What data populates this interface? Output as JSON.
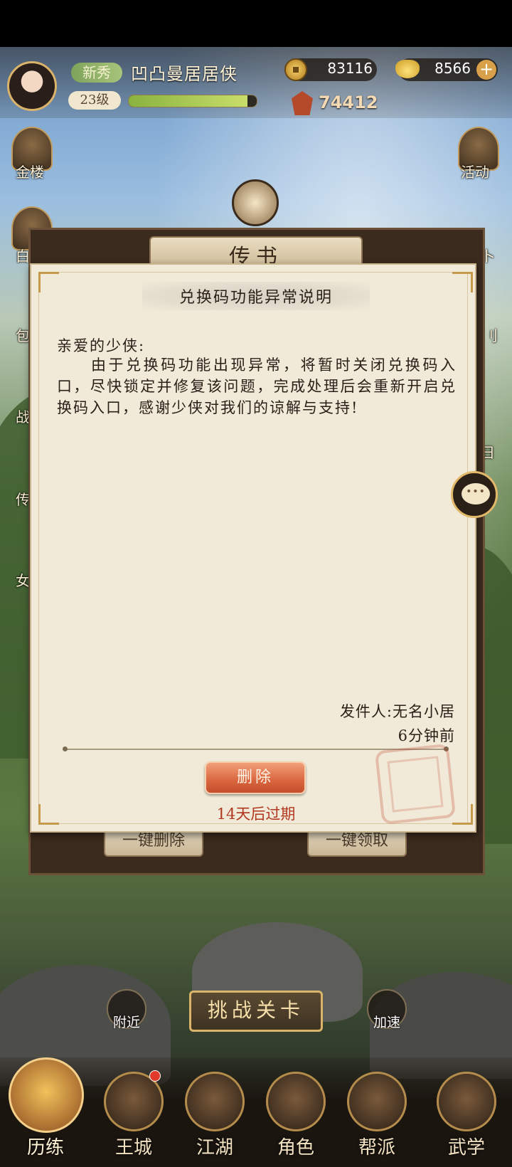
{
  "header": {
    "rank_tag": "新秀",
    "player_name": "凹凸曼居居侠",
    "level": "23级",
    "exp_progress": 0.93,
    "coins": "83116",
    "ingots": "8566",
    "power": "74412"
  },
  "side_left": {
    "gold_tower": "金楼",
    "partial_1": "白",
    "partial_2": "包",
    "partial_3": "战",
    "partial_4": "传",
    "partial_5": "女"
  },
  "side_right": {
    "activity": "活动",
    "partial_1": "卜",
    "partial_2": "刂",
    "partial_3": "日"
  },
  "mailbox": {
    "title": "传书",
    "delete_all": "一键删除",
    "claim_all": "一键领取"
  },
  "letter": {
    "title": "兑换码功能异常说明",
    "greeting": "亲爱的少侠:",
    "body": "由于兑换码功能出现异常，将暂时关闭兑换码入口，尽快锁定并修复该问题，完成处理后会重新开启兑换码入口，感谢少侠对我们的谅解与支持!",
    "sender": "发件人:无名小居",
    "time": "6分钟前",
    "delete_button": "删除",
    "expiry": "14天后过期"
  },
  "actions": {
    "nearby": "附近",
    "challenge": "挑战关卡",
    "speed_up": "加速"
  },
  "nav": [
    {
      "label": "历练"
    },
    {
      "label": "王城"
    },
    {
      "label": "江湖"
    },
    {
      "label": "角色"
    },
    {
      "label": "帮派"
    },
    {
      "label": "武学"
    }
  ],
  "colors": {
    "parchment": "#f1ead8",
    "delete_button": "#d9653e",
    "expiry_text": "#b1361e",
    "gold_accent": "#d9b46a"
  }
}
